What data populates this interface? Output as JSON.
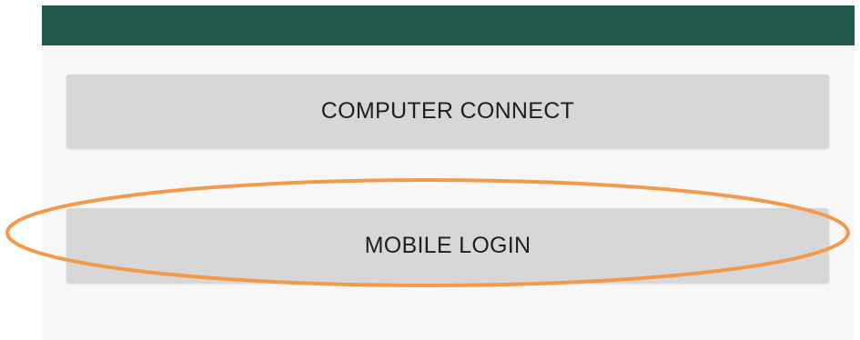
{
  "header": {
    "color": "#22574b"
  },
  "buttons": {
    "computer_connect_label": "COMPUTER CONNECT",
    "mobile_login_label": "MOBILE LOGIN",
    "background": "#d6d7d6"
  },
  "annotation": {
    "shape": "ellipse",
    "target": "mobile-login-button",
    "color": "#f39a4a"
  }
}
